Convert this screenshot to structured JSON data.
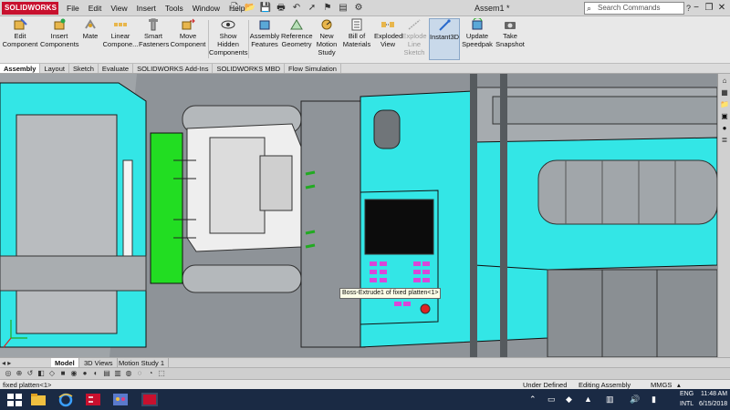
{
  "app": {
    "logo_text": "SOLIDWORKS",
    "document_title": "Assem1 *"
  },
  "menu": [
    "File",
    "Edit",
    "View",
    "Insert",
    "Tools",
    "Window",
    "Help"
  ],
  "search": {
    "placeholder": "Search Commands",
    "help_icon": "?"
  },
  "window_controls": [
    "−",
    "❐",
    "✕"
  ],
  "ribbon": {
    "buttons": [
      {
        "label_1": "Edit",
        "label_2": "Component",
        "label_3": "",
        "icon": "edit-component-icon",
        "state": "normal"
      },
      {
        "label_1": "Insert",
        "label_2": "Components",
        "label_3": "",
        "icon": "insert-components-icon",
        "state": "normal"
      },
      {
        "label_1": "Mate",
        "label_2": "",
        "label_3": "",
        "icon": "mate-icon",
        "state": "normal"
      },
      {
        "label_1": "Linear",
        "label_2": "Compone...",
        "label_3": "",
        "icon": "linear-pattern-icon",
        "state": "normal"
      },
      {
        "label_1": "Smart",
        "label_2": "Fasteners",
        "label_3": "",
        "icon": "smart-fasteners-icon",
        "state": "normal"
      },
      {
        "label_1": "Move",
        "label_2": "Component",
        "label_3": "",
        "icon": "move-component-icon",
        "state": "normal"
      },
      {
        "label_1": "Show",
        "label_2": "Hidden",
        "label_3": "Components",
        "icon": "show-hidden-icon",
        "state": "normal"
      },
      {
        "label_1": "Assembly",
        "label_2": "Features",
        "label_3": "",
        "icon": "assembly-features-icon",
        "state": "normal"
      },
      {
        "label_1": "Reference",
        "label_2": "Geometry",
        "label_3": "",
        "icon": "reference-geometry-icon",
        "state": "normal"
      },
      {
        "label_1": "New",
        "label_2": "Motion",
        "label_3": "Study",
        "icon": "new-motion-study-icon",
        "state": "normal"
      },
      {
        "label_1": "Bill of",
        "label_2": "Materials",
        "label_3": "",
        "icon": "bill-of-materials-icon",
        "state": "normal"
      },
      {
        "label_1": "Exploded",
        "label_2": "View",
        "label_3": "",
        "icon": "exploded-view-icon",
        "state": "normal"
      },
      {
        "label_1": "Explode",
        "label_2": "Line",
        "label_3": "Sketch",
        "icon": "explode-line-sketch-icon",
        "state": "disabled"
      },
      {
        "label_1": "Instant3D",
        "label_2": "",
        "label_3": "",
        "icon": "instant3d-icon",
        "state": "active"
      },
      {
        "label_1": "Update",
        "label_2": "Speedpak",
        "label_3": "",
        "icon": "update-speedpak-icon",
        "state": "normal"
      },
      {
        "label_1": "Take",
        "label_2": "Snapshot",
        "label_3": "",
        "icon": "take-snapshot-icon",
        "state": "normal"
      }
    ]
  },
  "command_tabs": [
    "Assembly",
    "Layout",
    "Sketch",
    "Evaluate",
    "SOLIDWORKS Add-Ins",
    "SOLIDWORKS MBD",
    "Flow Simulation"
  ],
  "active_command_tab": "Assembly",
  "viewport": {
    "tooltip": "Boss-Extrude1 of fixed platten<1>"
  },
  "bottom_tabs": [
    "Model",
    "3D Views",
    "Motion Study 1"
  ],
  "bottom_nav": "◂ ▸",
  "status": {
    "selection": "fixed platten<1>",
    "state": "Under Defined",
    "mode": "Editing Assembly",
    "units": "MMGS",
    "units_arrow": "▴"
  },
  "taskbar": {
    "lang_1": "ENG",
    "lang_2": "INTL",
    "time": "11:48 AM",
    "date": "6/15/2018"
  },
  "colors": {
    "accent_cyan": "#33e6e6",
    "green_face": "#22dd22",
    "solidworks_red": "#c8102e"
  }
}
